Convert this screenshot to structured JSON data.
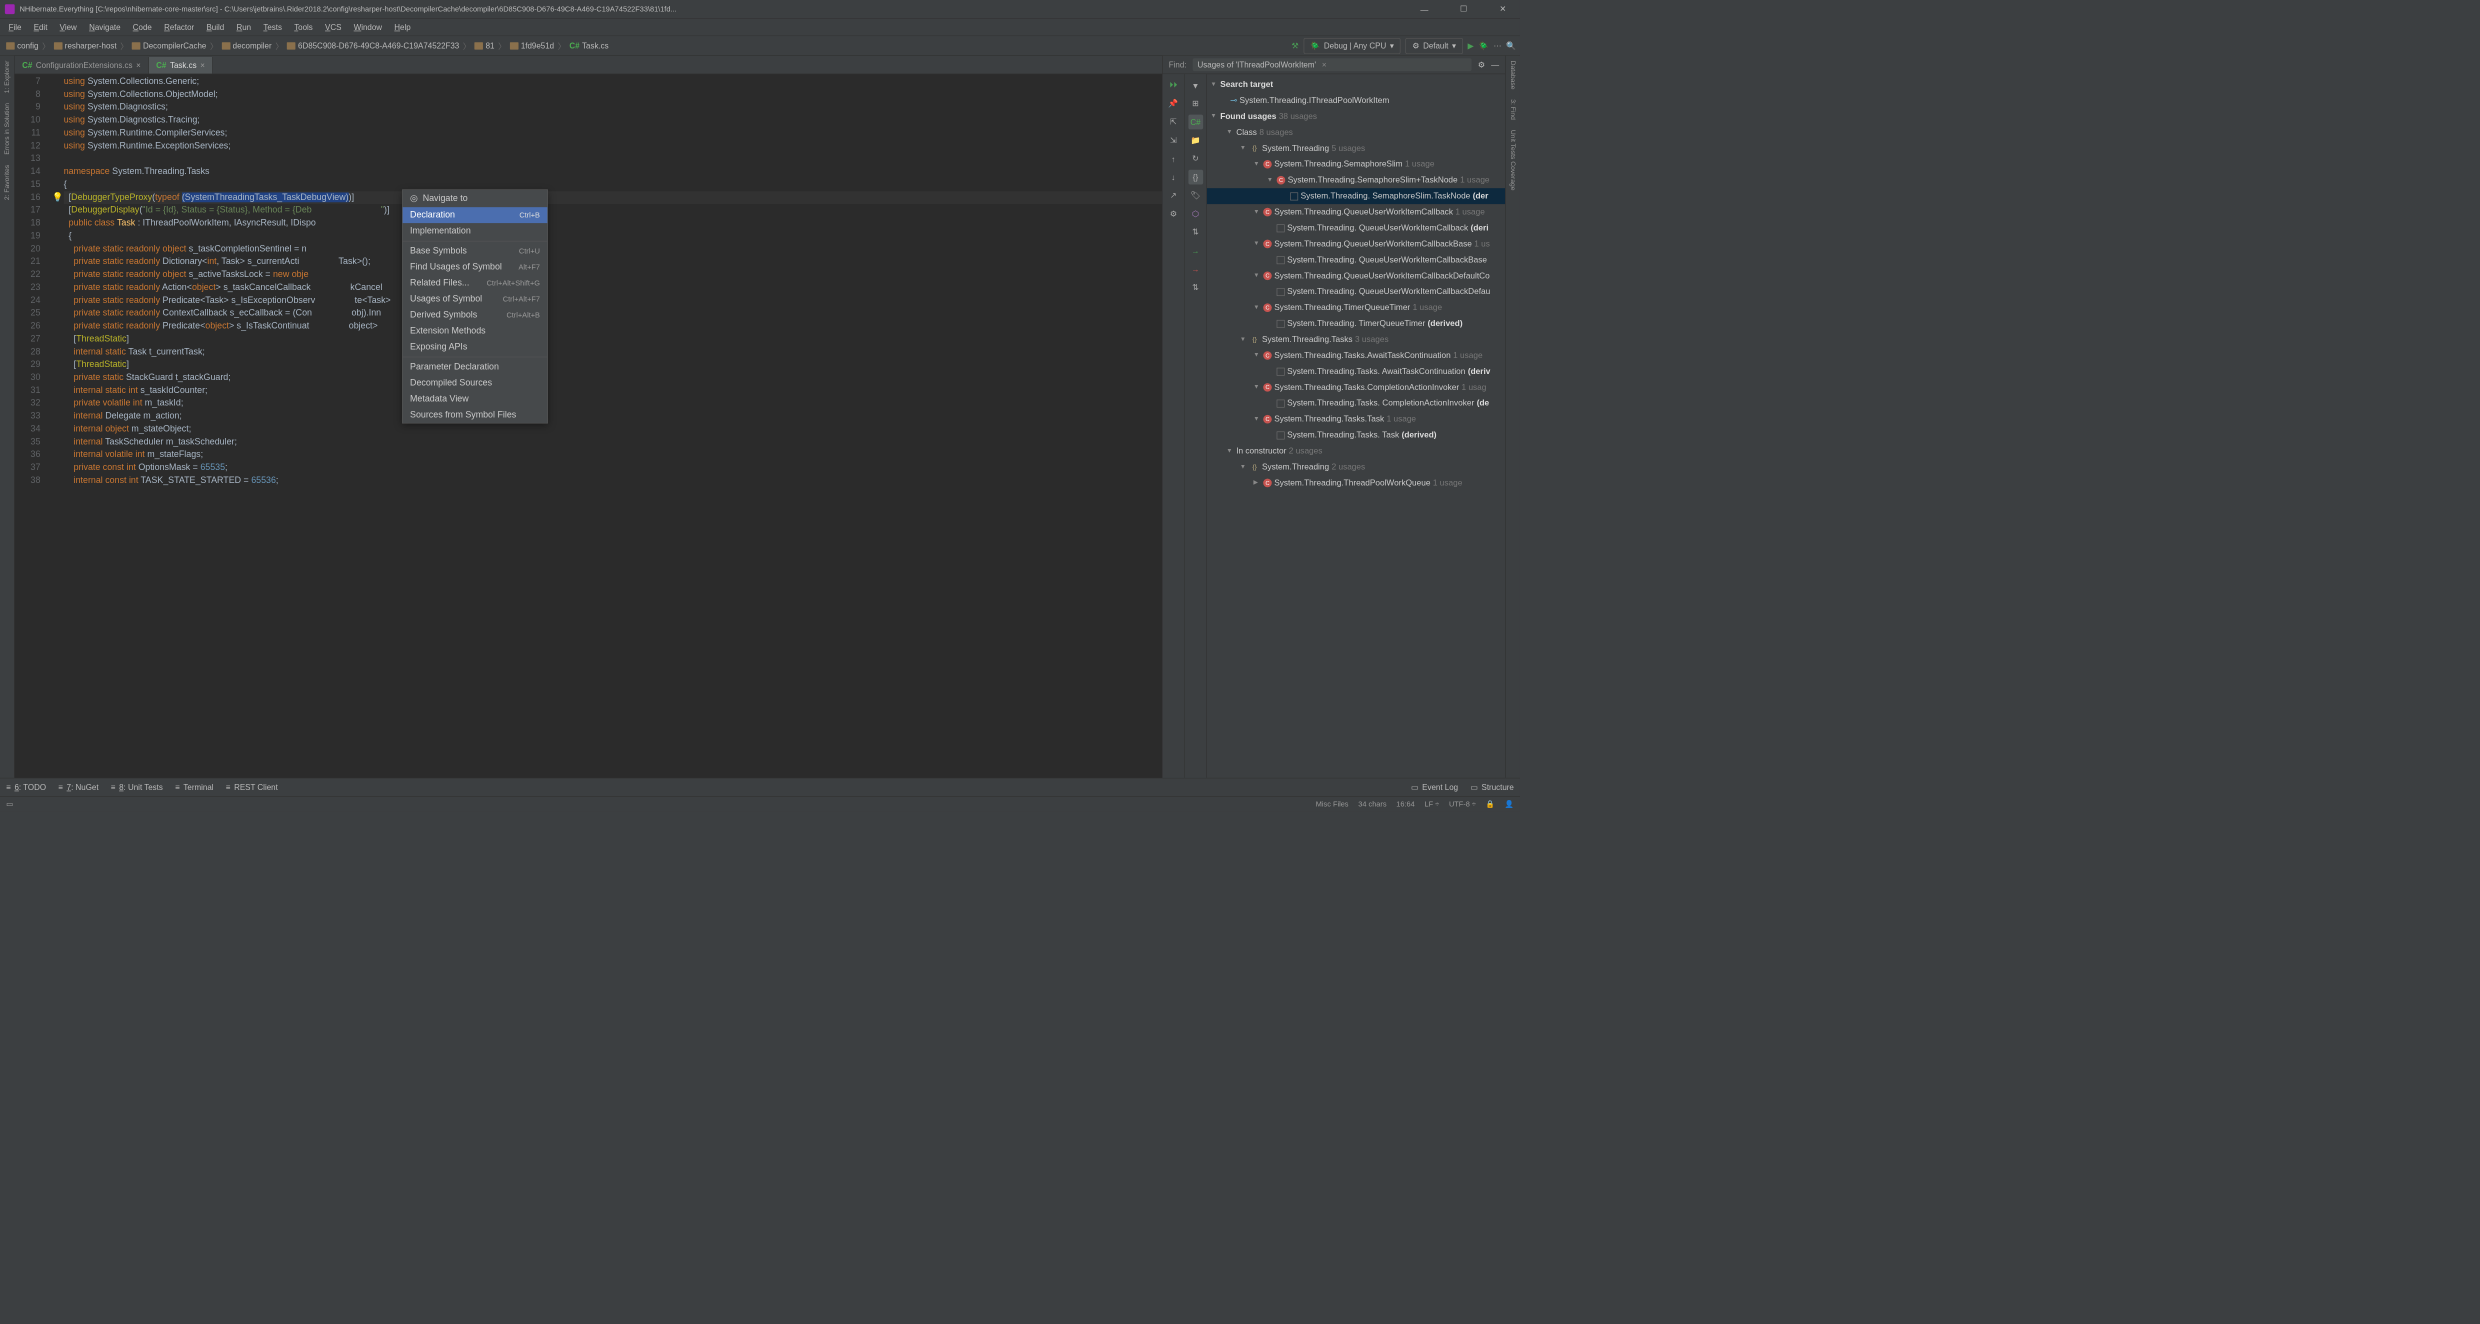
{
  "window": {
    "title": "NHibernate.Everything [C:\\repos\\nhibernate-core-master\\src] - C:\\Users\\jetbrains\\.Rider2018.2\\config\\resharper-host\\DecompilerCache\\decompiler\\6D85C908-D676-49C8-A469-C19A74522F33\\81\\1fd..."
  },
  "menu": [
    "File",
    "Edit",
    "View",
    "Navigate",
    "Code",
    "Refactor",
    "Build",
    "Run",
    "Tests",
    "Tools",
    "VCS",
    "Window",
    "Help"
  ],
  "breadcrumbs": [
    "config",
    "resharper-host",
    "DecompilerCache",
    "decompiler",
    "6D85C908-D676-49C8-A469-C19A74522F33",
    "81",
    "1fd9e51d",
    "Task.cs"
  ],
  "run_config": "Debug | Any CPU",
  "build_config": "Default",
  "tabs": [
    {
      "label": "ConfigurationExtensions.cs",
      "active": false
    },
    {
      "label": "Task.cs",
      "active": true
    }
  ],
  "left_tools": [
    "1: Explorer",
    "Errors in Solution",
    "2: Favorites"
  ],
  "right_tools": [
    "Database",
    "3: Find",
    "Unit Tests Coverage"
  ],
  "code_lines": [
    {
      "n": 7,
      "html": "<span class='kw'>using</span> System.Collections.Generic;"
    },
    {
      "n": 8,
      "html": "<span class='kw'>using</span> System.Collections.ObjectModel;"
    },
    {
      "n": 9,
      "html": "<span class='kw'>using</span> System.Diagnostics;"
    },
    {
      "n": 10,
      "html": "<span class='kw'>using</span> System.Diagnostics.Tracing;"
    },
    {
      "n": 11,
      "html": "<span class='kw'>using</span> System.Runtime.CompilerServices;"
    },
    {
      "n": 12,
      "html": "<span class='kw'>using</span> System.Runtime.ExceptionServices;"
    },
    {
      "n": 13,
      "html": ""
    },
    {
      "n": 14,
      "html": "<span class='kw'>namespace</span> <span class='type'>System.Threading.Tasks</span>"
    },
    {
      "n": 15,
      "html": "{"
    },
    {
      "n": 16,
      "html": "  [<span class='attr'>DebuggerTypeProxy</span>(<span class='kw'>typeof</span> <span class='sel'>(SystemThreadingTasks_TaskDebugView)</span>)]",
      "icon": "bulb"
    },
    {
      "n": 17,
      "html": "  [<span class='attr'>DebuggerDisplay</span>(<span class='str'>\"Id = {Id}, Status = {Status}, Method = {Deb</span>                            <span class='str'>\"</span>)]"
    },
    {
      "n": 18,
      "html": "  <span class='kw'>public class</span> <span class='id'>Task</span> : IThreadPoolWorkItem, IAsyncResult, IDispo"
    },
    {
      "n": 19,
      "html": "  {"
    },
    {
      "n": 20,
      "html": "    <span class='kw'>private static readonly object</span> s_taskCompletionSentinel = n"
    },
    {
      "n": 21,
      "html": "    <span class='kw'>private static readonly</span> Dictionary&lt;<span class='kw'>int</span>, Task&gt; s_currentActi                <span class='type'>Task</span>&gt;();"
    },
    {
      "n": 22,
      "html": "    <span class='kw'>private static readonly object</span> s_activeTasksLock = <span class='kw'>new obje</span>"
    },
    {
      "n": 23,
      "html": "    <span class='kw'>private static readonly</span> Action&lt;<span class='kw'>object</span>&gt; s_taskCancelCallback                <span class='type'>kCancel</span>"
    },
    {
      "n": 24,
      "html": "    <span class='kw'>private static readonly</span> Predicate&lt;Task&gt; s_IsExceptionObserv                <span class='type'>te&lt;Task&gt;</span>"
    },
    {
      "n": 25,
      "html": "    <span class='kw'>private static readonly</span> ContextCallback s_ecCallback = (Con                <span class='type'>obj).Inn</span>"
    },
    {
      "n": 26,
      "html": "    <span class='kw'>private static readonly</span> Predicate&lt;<span class='kw'>object</span>&gt; s_IsTaskContinuat                <span class='type'>object</span>&gt;"
    },
    {
      "n": 27,
      "html": "    [<span class='attr'>ThreadStatic</span>]"
    },
    {
      "n": 28,
      "html": "    <span class='kw'>internal static</span> Task t_currentTask;"
    },
    {
      "n": 29,
      "html": "    [<span class='attr'>ThreadStatic</span>]"
    },
    {
      "n": 30,
      "html": "    <span class='kw'>private static</span> StackGuard t_stackGuard;"
    },
    {
      "n": 31,
      "html": "    <span class='kw'>internal static int</span> s_taskIdCounter;"
    },
    {
      "n": 32,
      "html": "    <span class='kw'>private volatile int</span> m_taskId;"
    },
    {
      "n": 33,
      "html": "    <span class='kw'>internal</span> Delegate m_action;"
    },
    {
      "n": 34,
      "html": "    <span class='kw'>internal object</span> m_stateObject;"
    },
    {
      "n": 35,
      "html": "    <span class='kw'>internal</span> TaskScheduler m_taskScheduler;"
    },
    {
      "n": 36,
      "html": "    <span class='kw'>internal volatile int</span> m_stateFlags;"
    },
    {
      "n": 37,
      "html": "    <span class='kw'>private const int</span> OptionsMask = <span class='num'>65535</span>;"
    },
    {
      "n": 38,
      "html": "    <span class='kw'>internal const int</span> TASK_STATE_STARTED = <span class='num'>65536</span>;"
    }
  ],
  "context_menu": {
    "title": "Navigate to",
    "items": [
      {
        "label": "Declaration",
        "shortcut": "Ctrl+B",
        "hl": true
      },
      {
        "label": "Implementation",
        "shortcut": ""
      },
      {
        "sep": true
      },
      {
        "label": "Base Symbols",
        "shortcut": "Ctrl+U"
      },
      {
        "label": "Find Usages of Symbol",
        "shortcut": "Alt+F7"
      },
      {
        "label": "Related Files...",
        "shortcut": "Ctrl+Alt+Shift+G"
      },
      {
        "label": "Usages of Symbol",
        "shortcut": "Ctrl+Alt+F7"
      },
      {
        "label": "Derived Symbols",
        "shortcut": "Ctrl+Alt+B"
      },
      {
        "label": "Extension Methods",
        "shortcut": ""
      },
      {
        "label": "Exposing APIs",
        "shortcut": ""
      },
      {
        "sep": true
      },
      {
        "label": "Parameter Declaration",
        "shortcut": ""
      },
      {
        "label": "Decompiled Sources",
        "shortcut": ""
      },
      {
        "label": "Metadata View",
        "shortcut": ""
      },
      {
        "label": "Sources from Symbol Files",
        "shortcut": ""
      }
    ]
  },
  "find": {
    "label": "Find:",
    "title": "Usages of 'IThreadPoolWorkItem'",
    "search_target": "Search target",
    "target_name": "System.Threading.IThreadPoolWorkItem",
    "found_label": "Found usages",
    "found_count": "38 usages",
    "tree": [
      {
        "d": 1,
        "exp": "▼",
        "icon": "",
        "label": "Class",
        "count": "8 usages"
      },
      {
        "d": 2,
        "exp": "▼",
        "icon": "ns",
        "label": "System.Threading",
        "count": "5 usages"
      },
      {
        "d": 3,
        "exp": "▼",
        "icon": "c",
        "label": "System.Threading.SemaphoreSlim",
        "count": "1 usage"
      },
      {
        "d": 4,
        "exp": "▼",
        "icon": "c",
        "label": "System.Threading.SemaphoreSlim+TaskNode",
        "count": "1 usage"
      },
      {
        "d": 5,
        "exp": "",
        "icon": "cb",
        "label": "System.Threading. SemaphoreSlim.TaskNode ",
        "bold": "(der",
        "sel": true
      },
      {
        "d": 3,
        "exp": "▼",
        "icon": "c",
        "label": "System.Threading.QueueUserWorkItemCallback",
        "count": "1 usage"
      },
      {
        "d": 4,
        "exp": "",
        "icon": "cb",
        "label": "System.Threading. QueueUserWorkItemCallback ",
        "bold": "(deri"
      },
      {
        "d": 3,
        "exp": "▼",
        "icon": "c",
        "label": "System.Threading.QueueUserWorkItemCallbackBase",
        "count": "1 us"
      },
      {
        "d": 4,
        "exp": "",
        "icon": "cb",
        "label": "System.Threading. QueueUserWorkItemCallbackBase ",
        "bold": ""
      },
      {
        "d": 3,
        "exp": "▼",
        "icon": "c",
        "label": "System.Threading.QueueUserWorkItemCallbackDefaultCo",
        "count": ""
      },
      {
        "d": 4,
        "exp": "",
        "icon": "cb",
        "label": "System.Threading. QueueUserWorkItemCallbackDefau",
        "bold": ""
      },
      {
        "d": 3,
        "exp": "▼",
        "icon": "c",
        "label": "System.Threading.TimerQueueTimer",
        "count": "1 usage"
      },
      {
        "d": 4,
        "exp": "",
        "icon": "cb",
        "label": "System.Threading. TimerQueueTimer ",
        "bold": "(derived)"
      },
      {
        "d": 2,
        "exp": "▼",
        "icon": "ns",
        "label": "System.Threading.Tasks",
        "count": "3 usages"
      },
      {
        "d": 3,
        "exp": "▼",
        "icon": "c",
        "label": "System.Threading.Tasks.AwaitTaskContinuation",
        "count": "1 usage"
      },
      {
        "d": 4,
        "exp": "",
        "icon": "cb",
        "label": "System.Threading.Tasks. AwaitTaskContinuation ",
        "bold": "(deriv"
      },
      {
        "d": 3,
        "exp": "▼",
        "icon": "c",
        "label": "System.Threading.Tasks.CompletionActionInvoker",
        "count": "1 usag"
      },
      {
        "d": 4,
        "exp": "",
        "icon": "cb",
        "label": "System.Threading.Tasks. CompletionActionInvoker ",
        "bold": "(de"
      },
      {
        "d": 3,
        "exp": "▼",
        "icon": "c",
        "label": "System.Threading.Tasks.Task",
        "count": "1 usage"
      },
      {
        "d": 4,
        "exp": "",
        "icon": "cb",
        "label": "System.Threading.Tasks. Task ",
        "bold": "(derived)"
      },
      {
        "d": 1,
        "exp": "▼",
        "icon": "",
        "label": "In constructor",
        "count": "2 usages"
      },
      {
        "d": 2,
        "exp": "▼",
        "icon": "ns",
        "label": "System.Threading",
        "count": "2 usages"
      },
      {
        "d": 3,
        "exp": "▶",
        "icon": "c",
        "label": "System.Threading.ThreadPoolWorkQueue",
        "count": "1 usage"
      }
    ]
  },
  "bottom_tools": [
    {
      "label": "6: TODO",
      "u": "6"
    },
    {
      "label": "7: NuGet",
      "u": "7"
    },
    {
      "label": "8: Unit Tests",
      "u": "8"
    },
    {
      "label": "Terminal",
      "u": ""
    },
    {
      "label": "REST Client",
      "u": ""
    }
  ],
  "bottom_right": [
    "Event Log",
    "Structure"
  ],
  "status": {
    "misc": "Misc Files",
    "chars": "34 chars",
    "pos": "16:64",
    "lf": "LF",
    "enc": "UTF-8"
  }
}
